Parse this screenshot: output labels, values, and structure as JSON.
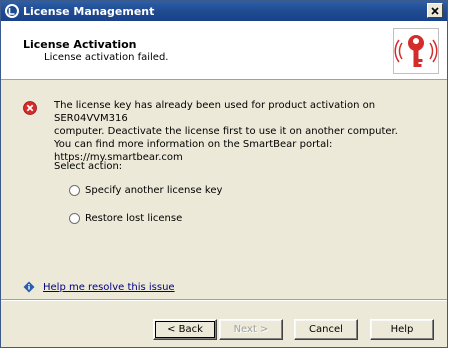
{
  "window": {
    "title": "License Management"
  },
  "header": {
    "title": "License Activation",
    "subtitle": "License activation failed."
  },
  "message": {
    "line1": "The license key has already been used for product activation on SER04VVM316",
    "line2": "computer. Deactivate the license first to use it on another computer.",
    "line3": "You can find more information on the SmartBear portal: https://my.smartbear.com"
  },
  "select_action": {
    "label": "Select action:",
    "options": [
      "Specify another license key",
      "Restore lost license"
    ],
    "selected": null
  },
  "help": {
    "link_text": "Help me resolve this issue"
  },
  "buttons": {
    "back": "< Back",
    "next": "Next >",
    "cancel": "Cancel",
    "help": "Help"
  },
  "colors": {
    "titlebar": "#1f4b91",
    "dialog_bg": "#ece9d8",
    "error_red": "#d42b2b",
    "link": "#000080"
  }
}
